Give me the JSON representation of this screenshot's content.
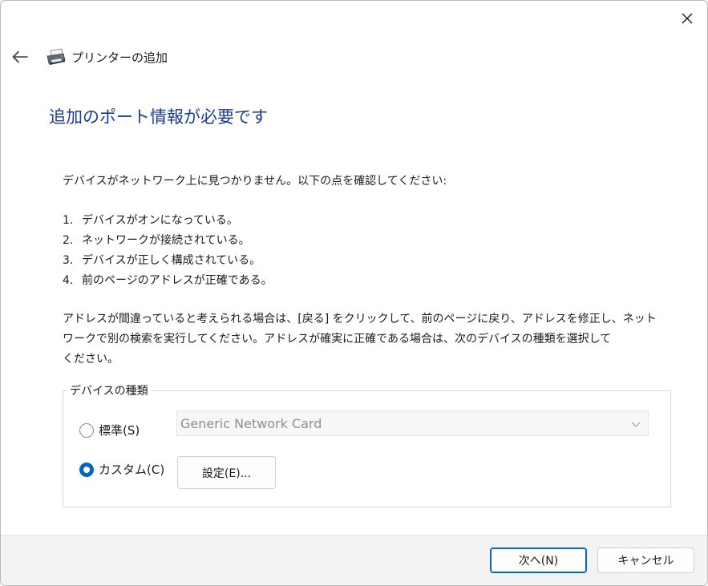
{
  "header": {
    "title": "プリンターの追加"
  },
  "page_title": "追加のポート情報が必要です",
  "intro": "デバイスがネットワーク上に見つかりません。以下の点を確認してください:",
  "checklist": [
    {
      "num": "1.",
      "text": "デバイスがオンになっている。"
    },
    {
      "num": "2.",
      "text": "ネットワークが接続されている。"
    },
    {
      "num": "3.",
      "text": "デバイスが正しく構成されている。"
    },
    {
      "num": "4.",
      "text": "前のページのアドレスが正確である。"
    }
  ],
  "advice": {
    "line1": "アドレスが間違っていると考えられる場合は、[戻る] をクリックして、前のページに戻り、アドレスを修正し、ネット",
    "line2": "ワークで別の検索を実行してください。アドレスが確実に正確である場合は、次のデバイスの種類を選択して",
    "line3": "ください。"
  },
  "device_type": {
    "legend": "デバイスの種類",
    "standard_label": "標準(S)",
    "standard_selected": false,
    "standard_value": "Generic Network Card",
    "custom_label": "カスタム(C)",
    "custom_selected": true,
    "settings_button": "設定(E)..."
  },
  "footer": {
    "next_button": "次へ(N)",
    "cancel_button": "キャンセル"
  },
  "colors": {
    "title": "#1a3d8f",
    "accent": "#0067c0"
  },
  "icons": [
    "close-icon",
    "back-arrow-icon",
    "printer-icon",
    "chevron-down-icon"
  ]
}
